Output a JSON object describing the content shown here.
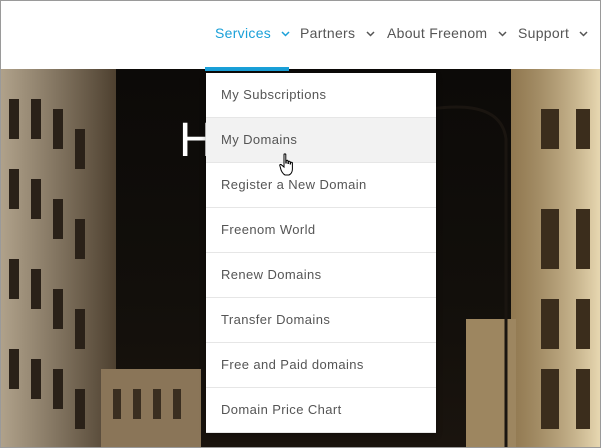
{
  "nav": {
    "items": [
      {
        "label": "Services",
        "active": true
      },
      {
        "label": "Partners",
        "active": false
      },
      {
        "label": "About Freenom",
        "active": false
      },
      {
        "label": "Support",
        "active": false
      }
    ]
  },
  "hero": {
    "title_fragment": "H"
  },
  "dropdown": {
    "items": [
      {
        "label": "My Subscriptions"
      },
      {
        "label": "My Domains",
        "hovered": true
      },
      {
        "label": "Register a New Domain"
      },
      {
        "label": "Freenom World"
      },
      {
        "label": "Renew Domains"
      },
      {
        "label": "Transfer Domains"
      },
      {
        "label": "Free and Paid domains"
      },
      {
        "label": "Domain Price Chart"
      }
    ]
  },
  "colors": {
    "accent": "#1aa0d8",
    "nav_text": "#555555",
    "hover_bg": "#f2f2f2"
  }
}
